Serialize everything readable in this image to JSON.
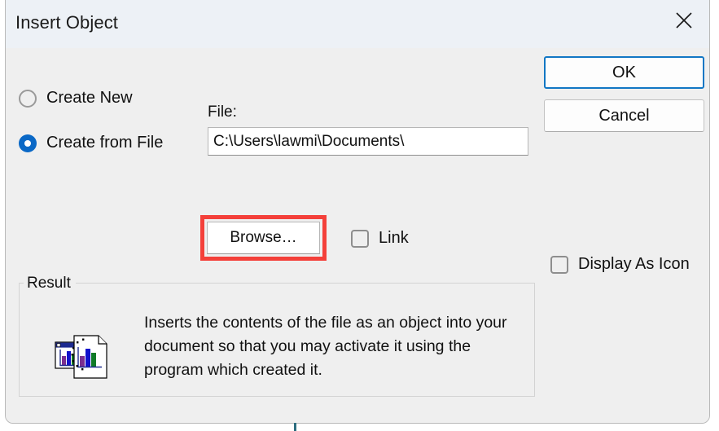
{
  "dialog": {
    "title": "Insert Object",
    "close_icon": "close-icon"
  },
  "source_options": {
    "create_new": {
      "label": "Create New",
      "selected": false
    },
    "create_from_file": {
      "label": "Create from File",
      "selected": true
    }
  },
  "file_section": {
    "label": "File:",
    "value": "C:\\Users\\lawmi\\Documents\\",
    "placeholder": "",
    "browse_label": "Browse…",
    "browse_highlighted": true,
    "highlight_color": "#f4403a"
  },
  "checkboxes": {
    "link": {
      "label": "Link",
      "checked": false
    },
    "display_as_icon": {
      "label": "Display As Icon",
      "checked": false
    }
  },
  "buttons": {
    "ok": "OK",
    "cancel": "Cancel",
    "ok_is_default": true,
    "ok_focus_color": "#1277c4"
  },
  "result": {
    "legend": "Result",
    "icon": "document-chart-icon",
    "description": "Inserts the contents of the file as an object into your document so that you may activate it using the program which created it."
  },
  "colors": {
    "titlebar_bg": "#edf1f6",
    "dialog_bg": "#efefef",
    "accent_blue": "#0a68c6",
    "text": "#111111"
  }
}
